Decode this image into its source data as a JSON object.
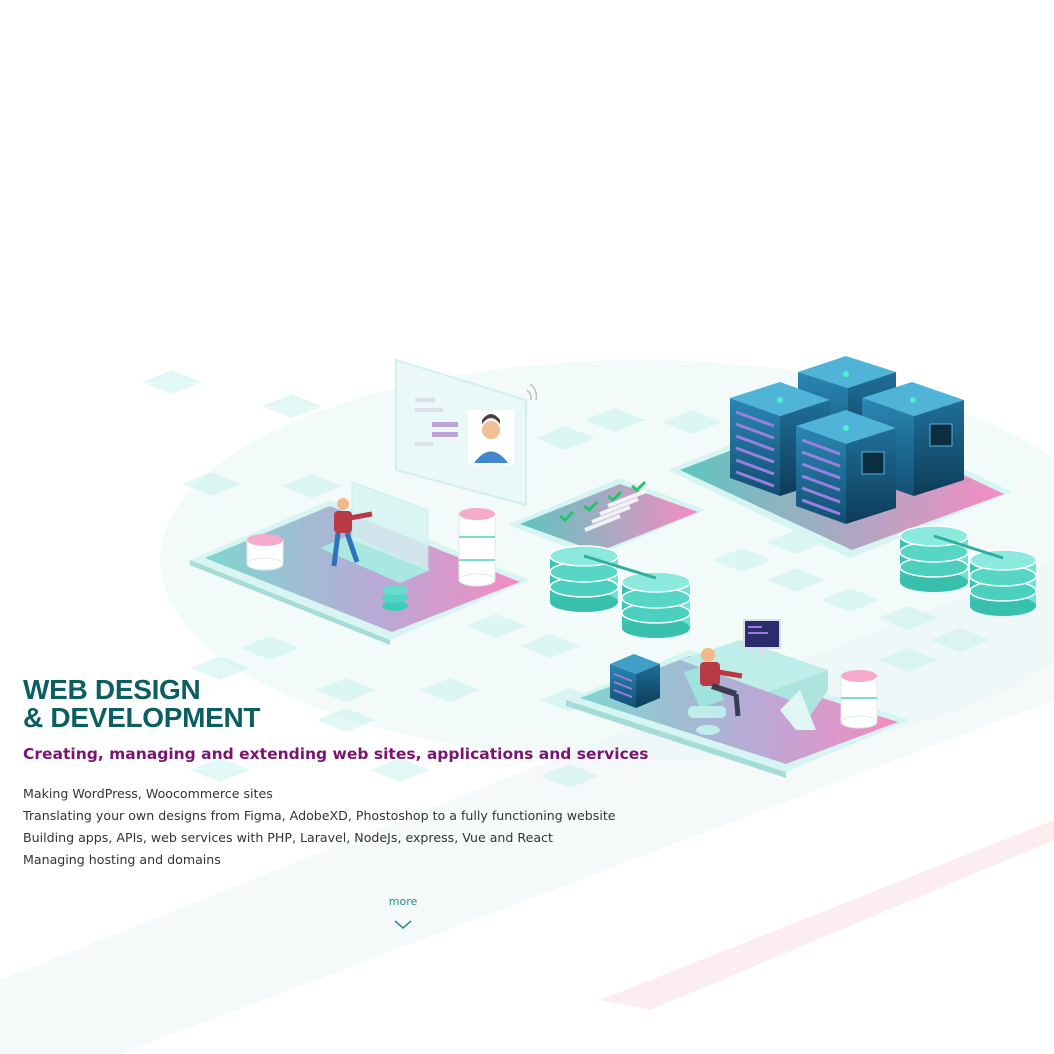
{
  "hero": {
    "title_line1": "WEB DESIGN",
    "title_line2": "& DEVELOPMENT",
    "subtitle": "Creating, managing and extending web sites, applications and services",
    "bullets": [
      "Making WordPress, Woocommerce sites",
      "Translating your own designs from Figma, AdobeXD, Phostoshop to a fully functioning website",
      "Building apps, APIs, web services with PHP, Laravel, NodeJs, express, Vue and React",
      "Managing hosting and domains"
    ],
    "more_label": "more"
  },
  "colors": {
    "title": "#0b5f62",
    "subtitle": "#7a1470",
    "body_text": "#333333",
    "accent_teal": "#2a8c8c",
    "server_blue": "#1d6f9a",
    "disk_teal": "#48d6c6",
    "panel_pink": "#f08ac0"
  },
  "icons": {
    "more": "chevron-down-icon"
  }
}
